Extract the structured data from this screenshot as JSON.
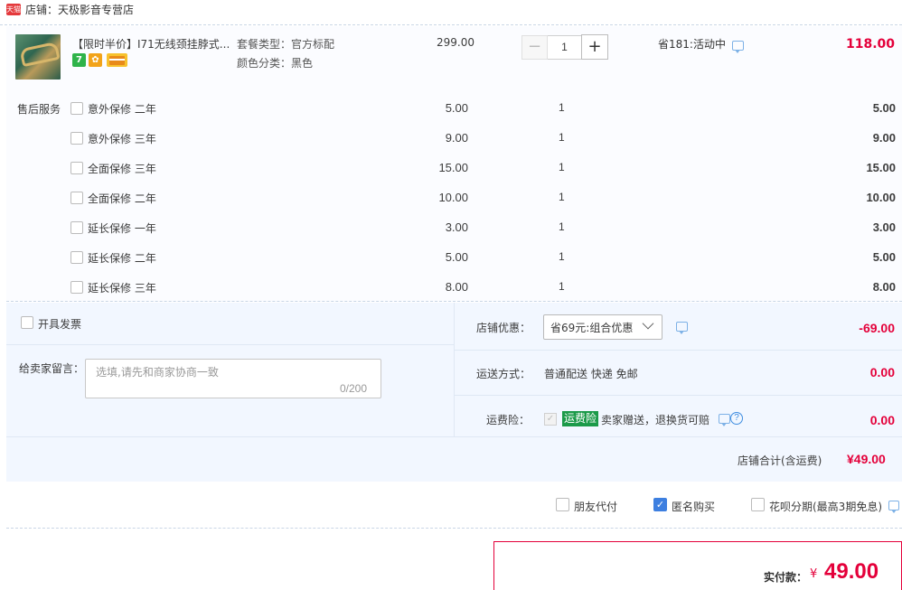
{
  "shop": {
    "badge": "天猫",
    "name": "店铺：天极影音专营店"
  },
  "product": {
    "title": "【限时半价】I71无线颈挂脖式...",
    "tags": [
      "7",
      "✿",
      ""
    ],
    "attr1": "套餐类型：官方标配",
    "attr2": "颜色分类：黑色",
    "price": "299.00",
    "quantity": "1",
    "qty_minus": "−",
    "qty_plus": "+",
    "promo": "省181:活动中",
    "subtotal": "118.00"
  },
  "services": {
    "label": "售后服务",
    "items": [
      {
        "name": "意外保修 二年",
        "price": "5.00",
        "qty": "1",
        "subtotal": "5.00"
      },
      {
        "name": "意外保修 三年",
        "price": "9.00",
        "qty": "1",
        "subtotal": "9.00"
      },
      {
        "name": "全面保修 三年",
        "price": "15.00",
        "qty": "1",
        "subtotal": "15.00"
      },
      {
        "name": "全面保修 二年",
        "price": "10.00",
        "qty": "1",
        "subtotal": "10.00"
      },
      {
        "name": "延长保修 一年",
        "price": "3.00",
        "qty": "1",
        "subtotal": "3.00"
      },
      {
        "name": "延长保修 二年",
        "price": "5.00",
        "qty": "1",
        "subtotal": "5.00"
      },
      {
        "name": "延长保修 三年",
        "price": "8.00",
        "qty": "1",
        "subtotal": "8.00"
      }
    ]
  },
  "invoice": {
    "label": "开具发票"
  },
  "message": {
    "label": "给卖家留言：",
    "placeholder": "选填,请先和商家协商一致",
    "counter": "0/200"
  },
  "coupon": {
    "label": "店铺优惠：",
    "selected": "省69元:组合优惠",
    "amount": "-69.00"
  },
  "shipping": {
    "label": "运送方式：",
    "value": "普通配送 快递 免邮",
    "amount": "0.00"
  },
  "insurance": {
    "label": "运费险：",
    "badge": "运费险",
    "text": "卖家赠送，退换货可赔",
    "amount": "0.00",
    "help": "?"
  },
  "shop_total": {
    "label": "店铺合计(含运费)",
    "amount": "¥49.00"
  },
  "options": [
    {
      "label": "朋友代付",
      "checked": false
    },
    {
      "label": "匿名购买",
      "checked": true
    },
    {
      "label": "花呗分期(最高3期免息)",
      "checked": false
    }
  ],
  "payment": {
    "label": "实付款：",
    "currency": "¥",
    "amount": "49.00"
  }
}
